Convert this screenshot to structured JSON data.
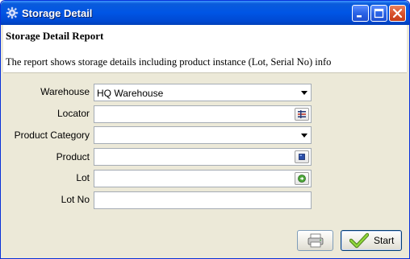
{
  "window": {
    "title": "Storage Detail",
    "icon": "gear-icon",
    "controls": [
      "minimize-icon",
      "maximize-icon",
      "close-icon"
    ]
  },
  "header": {
    "title": "Storage Detail Report",
    "description": "The report shows storage details including product instance (Lot, Serial No) info"
  },
  "form": {
    "warehouse": {
      "label": "Warehouse",
      "value": "HQ Warehouse",
      "type": "select"
    },
    "locator": {
      "label": "Locator",
      "value": "",
      "type": "search",
      "icon": "locator-icon"
    },
    "product_category": {
      "label": "Product Category",
      "value": "",
      "type": "select"
    },
    "product": {
      "label": "Product",
      "value": "",
      "type": "search",
      "icon": "product-icon"
    },
    "lot": {
      "label": "Lot",
      "value": "",
      "type": "search",
      "icon": "lot-icon"
    },
    "lot_no": {
      "label": "Lot No",
      "value": "",
      "type": "text"
    }
  },
  "buttons": {
    "print": {
      "icon": "print-icon"
    },
    "start": {
      "label": "Start",
      "icon": "checkmark-icon"
    }
  },
  "colors": {
    "title_bar": "#0055e5",
    "window_bg": "#ece9d8",
    "close_button": "#d9532e"
  }
}
